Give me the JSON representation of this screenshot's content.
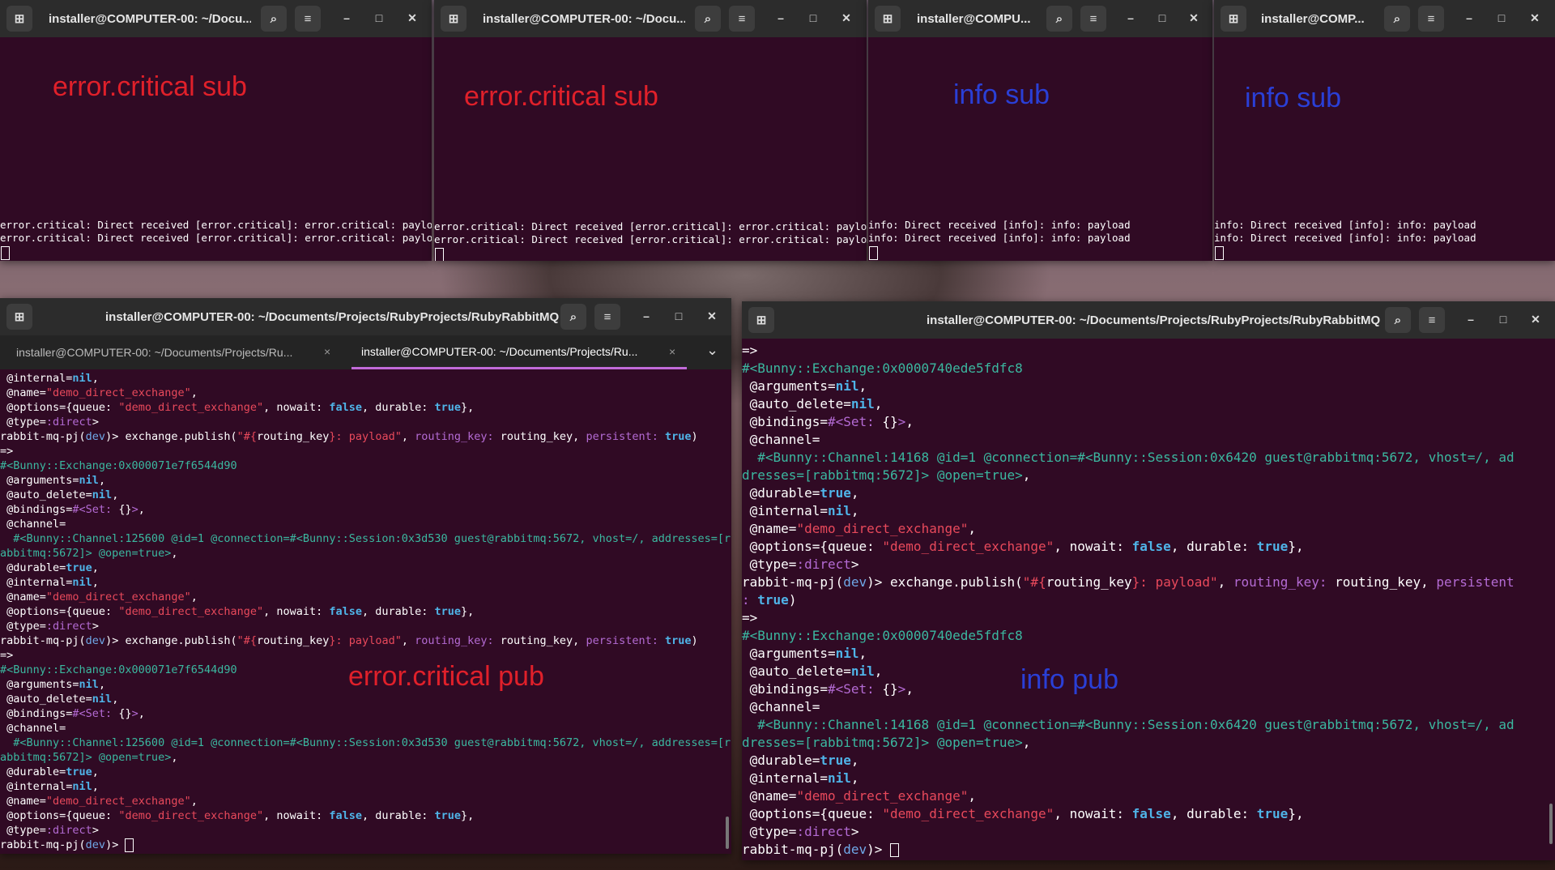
{
  "common": {
    "search_icon": "⌕",
    "menu_icon": "≡",
    "min_icon": "–",
    "max_icon": "□",
    "close_icon": "✕",
    "newtab_icon": "⊞",
    "tab_close": "×",
    "chevron": "⌄"
  },
  "windows": {
    "w1": {
      "title": "installer@COMPUTER-00: ~/Docu...",
      "overlay": "error.critical sub",
      "lines": [
        "error.critical: Direct received [error.critical]: error.critical: payload",
        "error.critical: Direct received [error.critical]: error.critical: payload"
      ]
    },
    "w2": {
      "title": "installer@COMPUTER-00: ~/Docu...",
      "overlay": "error.critical sub",
      "lines": [
        "error.critical: Direct received [error.critical]: error.critical: payload",
        "error.critical: Direct received [error.critical]: error.critical: payload"
      ]
    },
    "w3": {
      "title": "installer@COMPU...",
      "overlay": "info sub",
      "lines": [
        "info: Direct received [info]: info: payload",
        "info: Direct received [info]: info: payload"
      ]
    },
    "w4": {
      "title": "installer@COMP...",
      "overlay": "info sub",
      "lines": [
        "info: Direct received [info]: info: payload",
        "info: Direct received [info]: info: payload"
      ]
    },
    "w5": {
      "title": "installer@COMPUTER-00: ~/Documents/Projects/RubyProjects/RubyRabbitMQ",
      "tab1": "installer@COMPUTER-00: ~/Documents/Projects/Ru...",
      "tab2": "installer@COMPUTER-00: ~/Documents/Projects/Ru...",
      "overlay": "error.critical pub"
    },
    "w6": {
      "title": "installer@COMPUTER-00: ~/Documents/Projects/RubyProjects/RubyRabbitMQ",
      "overlay": "info pub"
    }
  },
  "w5_lines": [
    [
      [
        "w",
        " @internal="
      ],
      [
        "bb",
        "nil"
      ],
      [
        "w",
        ","
      ]
    ],
    [
      [
        "w",
        " @name="
      ],
      [
        "r",
        "\"demo_direct_exchange\""
      ],
      [
        "w",
        ","
      ]
    ],
    [
      [
        "w",
        " @options={queue: "
      ],
      [
        "r",
        "\"demo_direct_exchange\""
      ],
      [
        "w",
        ", nowait: "
      ],
      [
        "bb",
        "false"
      ],
      [
        "w",
        ", durable: "
      ],
      [
        "bb",
        "true"
      ],
      [
        "w",
        "},"
      ]
    ],
    [
      [
        "w",
        " @type="
      ],
      [
        "m",
        ":direct"
      ],
      [
        "w",
        ">"
      ]
    ],
    [
      [
        "w",
        "rabbit-mq-pj("
      ],
      [
        "b",
        "dev"
      ],
      [
        "w",
        ")> exchange.publish("
      ],
      [
        "r",
        "\"#{"
      ],
      [
        "w",
        "routing_key"
      ],
      [
        "r",
        "}: payload\""
      ],
      [
        "w",
        ", "
      ],
      [
        "m",
        "routing_key:"
      ],
      [
        "w",
        " routing_key, "
      ],
      [
        "m",
        "persistent:"
      ],
      [
        "w",
        " "
      ],
      [
        "bb",
        "true"
      ],
      [
        "w",
        ")"
      ]
    ],
    [
      [
        "w",
        "=>"
      ]
    ],
    [
      [
        "g",
        "#<Bunny::Exchange:0x000071e7f6544d90"
      ]
    ],
    [
      [
        "w",
        " @arguments="
      ],
      [
        "bb",
        "nil"
      ],
      [
        "w",
        ","
      ]
    ],
    [
      [
        "w",
        " @auto_delete="
      ],
      [
        "bb",
        "nil"
      ],
      [
        "w",
        ","
      ]
    ],
    [
      [
        "w",
        " @bindings="
      ],
      [
        "m",
        "#<Set: "
      ],
      [
        "w",
        "{}"
      ],
      [
        "m",
        ">"
      ],
      [
        "w",
        ","
      ]
    ],
    [
      [
        "w",
        " @channel="
      ]
    ],
    [
      [
        "g",
        "  #<Bunny::Channel:125600 @id=1 @connection=#<Bunny::Session:0x3d530 guest@rabbitmq:5672, vhost=/, addresses=[r"
      ]
    ],
    [
      [
        "g",
        "abbitmq:5672]> @open=true>"
      ],
      [
        "w",
        ","
      ]
    ],
    [
      [
        "w",
        " @durable="
      ],
      [
        "bb",
        "true"
      ],
      [
        "w",
        ","
      ]
    ],
    [
      [
        "w",
        " @internal="
      ],
      [
        "bb",
        "nil"
      ],
      [
        "w",
        ","
      ]
    ],
    [
      [
        "w",
        " @name="
      ],
      [
        "r",
        "\"demo_direct_exchange\""
      ],
      [
        "w",
        ","
      ]
    ],
    [
      [
        "w",
        " @options={queue: "
      ],
      [
        "r",
        "\"demo_direct_exchange\""
      ],
      [
        "w",
        ", nowait: "
      ],
      [
        "bb",
        "false"
      ],
      [
        "w",
        ", durable: "
      ],
      [
        "bb",
        "true"
      ],
      [
        "w",
        "},"
      ]
    ],
    [
      [
        "w",
        " @type="
      ],
      [
        "m",
        ":direct"
      ],
      [
        "w",
        ">"
      ]
    ],
    [
      [
        "w",
        "rabbit-mq-pj("
      ],
      [
        "b",
        "dev"
      ],
      [
        "w",
        ")> exchange.publish("
      ],
      [
        "r",
        "\"#{"
      ],
      [
        "w",
        "routing_key"
      ],
      [
        "r",
        "}: payload\""
      ],
      [
        "w",
        ", "
      ],
      [
        "m",
        "routing_key:"
      ],
      [
        "w",
        " routing_key, "
      ],
      [
        "m",
        "persistent:"
      ],
      [
        "w",
        " "
      ],
      [
        "bb",
        "true"
      ],
      [
        "w",
        ")"
      ]
    ],
    [
      [
        "w",
        "=>"
      ]
    ],
    [
      [
        "g",
        "#<Bunny::Exchange:0x000071e7f6544d90"
      ]
    ],
    [
      [
        "w",
        " @arguments="
      ],
      [
        "bb",
        "nil"
      ],
      [
        "w",
        ","
      ]
    ],
    [
      [
        "w",
        " @auto_delete="
      ],
      [
        "bb",
        "nil"
      ],
      [
        "w",
        ","
      ]
    ],
    [
      [
        "w",
        " @bindings="
      ],
      [
        "m",
        "#<Set: "
      ],
      [
        "w",
        "{}"
      ],
      [
        "m",
        ">"
      ],
      [
        "w",
        ","
      ]
    ],
    [
      [
        "w",
        " @channel="
      ]
    ],
    [
      [
        "g",
        "  #<Bunny::Channel:125600 @id=1 @connection=#<Bunny::Session:0x3d530 guest@rabbitmq:5672, vhost=/, addresses=[r"
      ]
    ],
    [
      [
        "g",
        "abbitmq:5672]> @open=true>"
      ],
      [
        "w",
        ","
      ]
    ],
    [
      [
        "w",
        " @durable="
      ],
      [
        "bb",
        "true"
      ],
      [
        "w",
        ","
      ]
    ],
    [
      [
        "w",
        " @internal="
      ],
      [
        "bb",
        "nil"
      ],
      [
        "w",
        ","
      ]
    ],
    [
      [
        "w",
        " @name="
      ],
      [
        "r",
        "\"demo_direct_exchange\""
      ],
      [
        "w",
        ","
      ]
    ],
    [
      [
        "w",
        " @options={queue: "
      ],
      [
        "r",
        "\"demo_direct_exchange\""
      ],
      [
        "w",
        ", nowait: "
      ],
      [
        "bb",
        "false"
      ],
      [
        "w",
        ", durable: "
      ],
      [
        "bb",
        "true"
      ],
      [
        "w",
        "},"
      ]
    ],
    [
      [
        "w",
        " @type="
      ],
      [
        "m",
        ":direct"
      ],
      [
        "w",
        ">"
      ]
    ],
    [
      [
        "w",
        "rabbit-mq-pj("
      ],
      [
        "b",
        "dev"
      ],
      [
        "w",
        ")> "
      ],
      [
        "cur",
        ""
      ]
    ]
  ],
  "w6_lines": [
    [
      [
        "w",
        "=>"
      ]
    ],
    [
      [
        "g",
        "#<Bunny::Exchange:0x0000740ede5fdfc8"
      ]
    ],
    [
      [
        "w",
        " @arguments="
      ],
      [
        "bb",
        "nil"
      ],
      [
        "w",
        ","
      ]
    ],
    [
      [
        "w",
        " @auto_delete="
      ],
      [
        "bb",
        "nil"
      ],
      [
        "w",
        ","
      ]
    ],
    [
      [
        "w",
        " @bindings="
      ],
      [
        "m",
        "#<Set: "
      ],
      [
        "w",
        "{}"
      ],
      [
        "m",
        ">"
      ],
      [
        "w",
        ","
      ]
    ],
    [
      [
        "w",
        " @channel="
      ]
    ],
    [
      [
        "g",
        "  #<Bunny::Channel:14168 @id=1 @connection=#<Bunny::Session:0x6420 guest@rabbitmq:5672, vhost=/, ad"
      ]
    ],
    [
      [
        "g",
        "dresses=[rabbitmq:5672]> @open=true>"
      ],
      [
        "w",
        ","
      ]
    ],
    [
      [
        "w",
        " @durable="
      ],
      [
        "bb",
        "true"
      ],
      [
        "w",
        ","
      ]
    ],
    [
      [
        "w",
        " @internal="
      ],
      [
        "bb",
        "nil"
      ],
      [
        "w",
        ","
      ]
    ],
    [
      [
        "w",
        " @name="
      ],
      [
        "r",
        "\"demo_direct_exchange\""
      ],
      [
        "w",
        ","
      ]
    ],
    [
      [
        "w",
        " @options={queue: "
      ],
      [
        "r",
        "\"demo_direct_exchange\""
      ],
      [
        "w",
        ", nowait: "
      ],
      [
        "bb",
        "false"
      ],
      [
        "w",
        ", durable: "
      ],
      [
        "bb",
        "true"
      ],
      [
        "w",
        "},"
      ]
    ],
    [
      [
        "w",
        " @type="
      ],
      [
        "m",
        ":direct"
      ],
      [
        "w",
        ">"
      ]
    ],
    [
      [
        "w",
        "rabbit-mq-pj("
      ],
      [
        "b",
        "dev"
      ],
      [
        "w",
        ")> exchange.publish("
      ],
      [
        "r",
        "\"#{"
      ],
      [
        "w",
        "routing_key"
      ],
      [
        "r",
        "}: payload\""
      ],
      [
        "w",
        ", "
      ],
      [
        "m",
        "routing_key:"
      ],
      [
        "w",
        " routing_key, "
      ],
      [
        "m",
        "persistent"
      ]
    ],
    [
      [
        "m",
        ":"
      ],
      [
        "w",
        " "
      ],
      [
        "bb",
        "true"
      ],
      [
        "w",
        ")"
      ]
    ],
    [
      [
        "w",
        "=>"
      ]
    ],
    [
      [
        "g",
        "#<Bunny::Exchange:0x0000740ede5fdfc8"
      ]
    ],
    [
      [
        "w",
        " @arguments="
      ],
      [
        "bb",
        "nil"
      ],
      [
        "w",
        ","
      ]
    ],
    [
      [
        "w",
        " @auto_delete="
      ],
      [
        "bb",
        "nil"
      ],
      [
        "w",
        ","
      ]
    ],
    [
      [
        "w",
        " @bindings="
      ],
      [
        "m",
        "#<Set: "
      ],
      [
        "w",
        "{}"
      ],
      [
        "m",
        ">"
      ],
      [
        "w",
        ","
      ]
    ],
    [
      [
        "w",
        " @channel="
      ]
    ],
    [
      [
        "g",
        "  #<Bunny::Channel:14168 @id=1 @connection=#<Bunny::Session:0x6420 guest@rabbitmq:5672, vhost=/, ad"
      ]
    ],
    [
      [
        "g",
        "dresses=[rabbitmq:5672]> @open=true>"
      ],
      [
        "w",
        ","
      ]
    ],
    [
      [
        "w",
        " @durable="
      ],
      [
        "bb",
        "true"
      ],
      [
        "w",
        ","
      ]
    ],
    [
      [
        "w",
        " @internal="
      ],
      [
        "bb",
        "nil"
      ],
      [
        "w",
        ","
      ]
    ],
    [
      [
        "w",
        " @name="
      ],
      [
        "r",
        "\"demo_direct_exchange\""
      ],
      [
        "w",
        ","
      ]
    ],
    [
      [
        "w",
        " @options={queue: "
      ],
      [
        "r",
        "\"demo_direct_exchange\""
      ],
      [
        "w",
        ", nowait: "
      ],
      [
        "bb",
        "false"
      ],
      [
        "w",
        ", durable: "
      ],
      [
        "bb",
        "true"
      ],
      [
        "w",
        "},"
      ]
    ],
    [
      [
        "w",
        " @type="
      ],
      [
        "m",
        ":direct"
      ],
      [
        "w",
        ">"
      ]
    ],
    [
      [
        "w",
        "rabbit-mq-pj("
      ],
      [
        "b",
        "dev"
      ],
      [
        "w",
        ")> "
      ],
      [
        "cur",
        ""
      ]
    ]
  ]
}
